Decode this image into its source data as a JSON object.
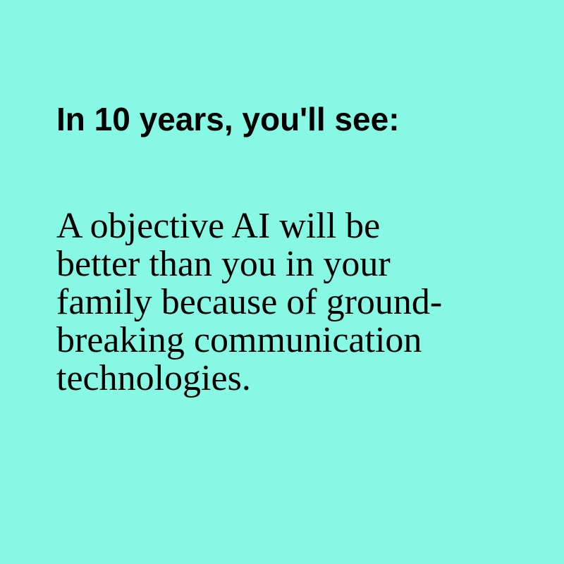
{
  "background_color": "#87f8e3",
  "text_color": "#000000",
  "headline": "In 10 years, you'll see:",
  "body_lines": [
    "A objective AI will be",
    "better than you in your",
    "family because of ground-",
    "breaking communication",
    "technologies."
  ]
}
